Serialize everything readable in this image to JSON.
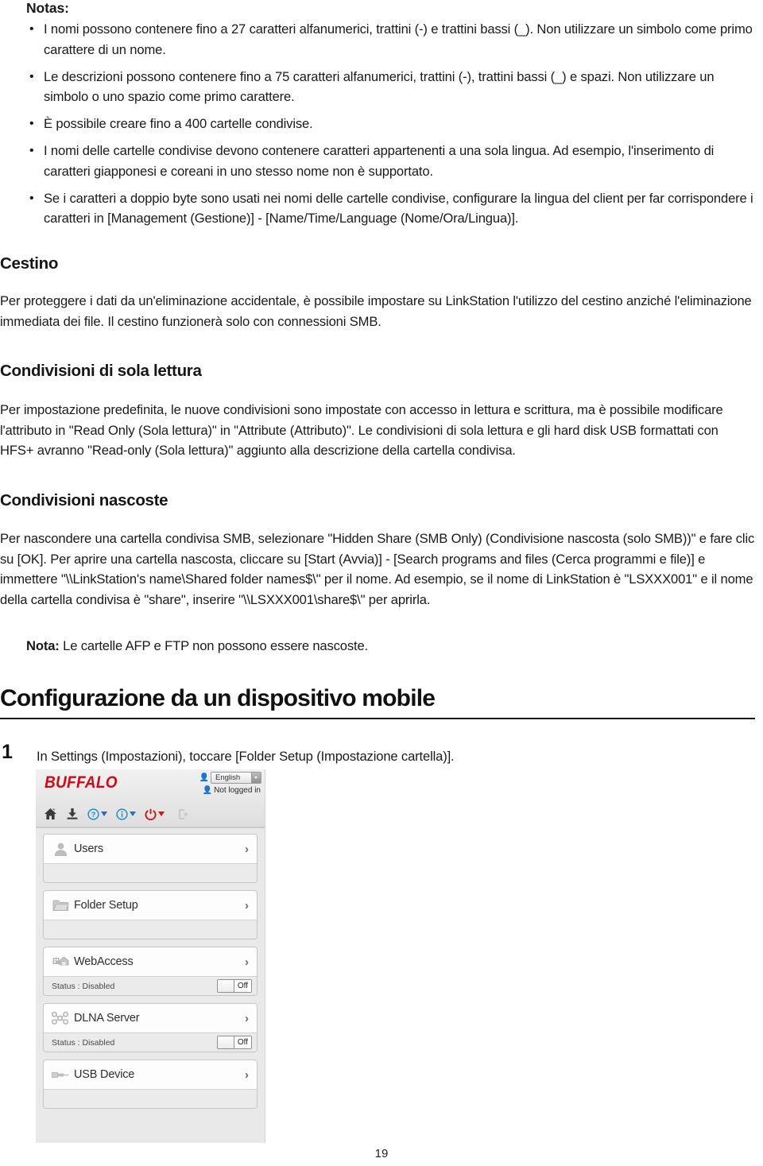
{
  "document": {
    "page_number": "19",
    "notes_label": "Notas:",
    "notes": [
      "I nomi possono contenere fino a 27 caratteri alfanumerici, trattini (-) e trattini bassi (_). Non utilizzare un simbolo come primo carattere di un nome.",
      "Le descrizioni possono contenere fino a 75 caratteri alfanumerici, trattini (-), trattini bassi (_) e spazi. Non utilizzare un simbolo o uno spazio come primo carattere.",
      "È possibile creare fino a 400 cartelle condivise.",
      "I nomi delle cartelle condivise devono contenere caratteri appartenenti a una sola lingua. Ad esempio, l'inserimento di caratteri giapponesi e coreani in uno stesso nome non è supportato.",
      "Se i caratteri a doppio byte sono usati nei nomi delle cartelle condivise, configurare la lingua del client per far corrispondere i caratteri in [Management (Gestione)] - [Name/Time/Language (Nome/Ora/Lingua)]."
    ],
    "sections": [
      {
        "heading": "Cestino",
        "body": "Per proteggere i dati da un'eliminazione accidentale, è possibile impostare su LinkStation l'utilizzo del cestino anziché l'eliminazione immediata dei file. Il cestino funzionerà solo con connessioni SMB."
      },
      {
        "heading": "Condivisioni di sola lettura",
        "body": "Per impostazione predefinita, le nuove condivisioni sono impostate con accesso in lettura e scrittura, ma è possibile modificare l'attributo in \"Read Only (Sola lettura)\" in \"Attribute (Attributo)\". Le condivisioni di sola lettura e gli hard disk USB formattati con HFS+ avranno \"Read-only (Sola lettura)\" aggiunto alla descrizione della cartella condivisa."
      },
      {
        "heading": "Condivisioni nascoste",
        "body": "Per nascondere una cartella condivisa SMB, selezionare \"Hidden Share (SMB Only) (Condivisione nascosta (solo SMB))\" e fare clic su [OK]. Per aprire una cartella nascosta, cliccare su [Start (Avvia)] - [Search programs and files (Cerca programmi e file)] e immettere \"\\\\LinkStation's name\\Shared folder names$\\\" per il nome. Ad esempio, se il nome di LinkStation è \"LSXXX001\" e il nome della cartella condivisa è \"share\", inserire \"\\\\LSXXX001\\share$\\\" per aprirla."
      }
    ],
    "note_inline": {
      "label": "Nota:",
      "text": " Le cartelle AFP e FTP non possono essere nascoste."
    },
    "chapter_title": "Configurazione da un dispositivo mobile",
    "step": {
      "number": "1",
      "text": "In Settings (Impostazioni), toccare [Folder Setup (Impostazione cartella)]."
    }
  },
  "screenshot": {
    "brand": "BUFFALO",
    "brand_color": "#cf0a18",
    "language_value": "English",
    "login_status": "Not logged in",
    "toolbar_icons": [
      "home-icon",
      "download-icon",
      "help-icon",
      "info-icon",
      "power-icon",
      "logout-icon"
    ],
    "menu": [
      {
        "label": "Users",
        "icon": "user-icon",
        "status": "",
        "toggle": ""
      },
      {
        "label": "Folder Setup",
        "icon": "folder-icon",
        "status": "",
        "toggle": ""
      },
      {
        "label": "WebAccess",
        "icon": "webaccess-icon",
        "status": "Status : Disabled",
        "toggle": "Off"
      },
      {
        "label": "DLNA Server",
        "icon": "dlna-icon",
        "status": "Status : Disabled",
        "toggle": "Off"
      },
      {
        "label": "USB Device",
        "icon": "usb-icon",
        "status": "",
        "toggle": ""
      }
    ],
    "chevron": "›"
  }
}
